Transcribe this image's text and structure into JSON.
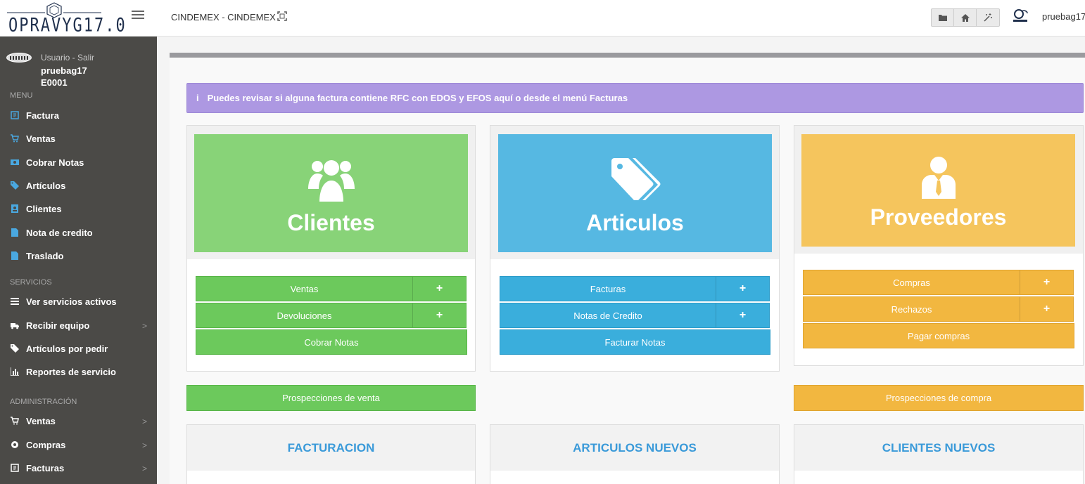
{
  "app": {
    "logo_text": "OPRAVYG17.0",
    "company": "CINDEMEX - CINDEMEX",
    "top_user": "pruebag17"
  },
  "toolbar": {
    "buttons": [
      {
        "icon": "folder-icon"
      },
      {
        "icon": "home-icon"
      },
      {
        "icon": "magic-wand-icon"
      }
    ]
  },
  "sidebar": {
    "user_link": "Usuario - Salir",
    "user_name": "pruebag17",
    "user_code": "E0001",
    "sections": [
      {
        "title": "MENU",
        "items": [
          {
            "label": "Factura",
            "icon": "invoice-icon"
          },
          {
            "label": "Ventas",
            "icon": "cart-icon"
          },
          {
            "label": "Cobrar Notas",
            "icon": "money-icon"
          },
          {
            "label": "Artículos",
            "icon": "tag-icon"
          },
          {
            "label": "Clientes",
            "icon": "address-book-icon"
          },
          {
            "label": "Nota de credito",
            "icon": "file-icon"
          },
          {
            "label": "Traslado",
            "icon": "file-icon"
          }
        ]
      },
      {
        "title": "SERVICIOS",
        "items": [
          {
            "label": "Ver servicios activos",
            "icon": "list-icon"
          },
          {
            "label": "Recibir equipo",
            "icon": "truck-icon",
            "arrow": ">"
          },
          {
            "label": "Artículos por pedir",
            "icon": "tags-icon"
          },
          {
            "label": "Reportes de servicio",
            "icon": "bar-chart-icon"
          }
        ]
      },
      {
        "title": "ADMINISTRACIÓN",
        "items": [
          {
            "label": "Ventas",
            "icon": "cart-icon",
            "arrow": ">"
          },
          {
            "label": "Compras",
            "icon": "gear-icon",
            "arrow": ">"
          },
          {
            "label": "Facturas",
            "icon": "invoice-icon",
            "arrow": ">"
          }
        ]
      }
    ]
  },
  "alert": {
    "icon": "i",
    "text": "Puedes revisar si alguna factura contiene RFC con EDOS y EFOS aquí o desde el menú Facturas"
  },
  "panels": {
    "clientes": {
      "title": "Clientes",
      "rows": [
        {
          "label": "Ventas",
          "plus": "+"
        },
        {
          "label": "Devoluciones",
          "plus": "+"
        }
      ],
      "full": "Cobrar Notas"
    },
    "articulos": {
      "title": "Articulos",
      "rows": [
        {
          "label": "Facturas",
          "plus": "+"
        },
        {
          "label": "Notas de Credito",
          "plus": "+"
        }
      ],
      "full": "Facturar Notas"
    },
    "proveedores": {
      "title": "Proveedores",
      "rows": [
        {
          "label": "Compras",
          "plus": "+"
        },
        {
          "label": "Rechazos",
          "plus": "+"
        }
      ],
      "full": "Pagar compras"
    }
  },
  "wide_buttons": {
    "venta": "Prospecciones de venta",
    "compra": "Prospecciones de compra"
  },
  "bottom_panels": [
    "FACTURACION",
    "ARTICULOS NUEVOS",
    "CLIENTES NUEVOS"
  ],
  "colors": {
    "green": "#6cc95c",
    "blue": "#3aaedc",
    "yellow": "#f2b740",
    "tile_green": "#88d378",
    "tile_blue": "#56b8e2",
    "tile_yellow": "#f5c55d",
    "alert": "#ad98e2",
    "sidebar": "#4b4a47"
  }
}
